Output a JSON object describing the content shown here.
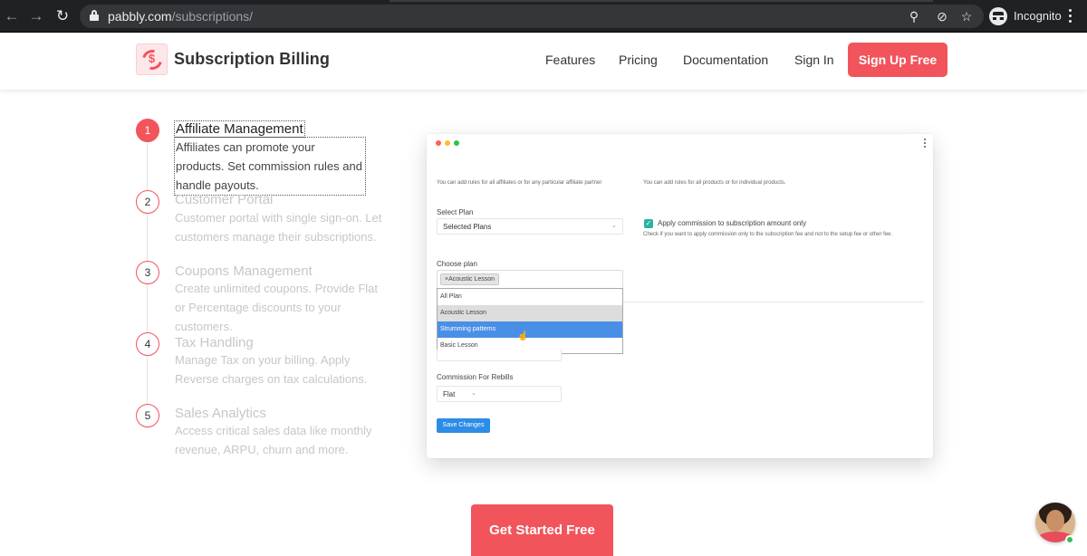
{
  "browser": {
    "url_host": "pabbly.com",
    "url_path": "/subscriptions/",
    "profile_label": "Incognito"
  },
  "header": {
    "brand": "Subscription Billing",
    "nav": [
      "Features",
      "Pricing",
      "Documentation",
      "Sign In"
    ],
    "cta": "Sign Up Free"
  },
  "features": [
    {
      "num": "1",
      "title": "Affiliate Management",
      "desc": "Affiliates can promote your products. Set commission rules and handle payouts.",
      "active": true
    },
    {
      "num": "2",
      "title": "Customer Portal",
      "desc": "Customer portal with single sign-on. Let customers manage their subscriptions.",
      "active": false
    },
    {
      "num": "3",
      "title": "Coupons Management",
      "desc": "Create unlimited coupons. Provide Flat or Percentage discounts to your customers.",
      "active": false
    },
    {
      "num": "4",
      "title": "Tax Handling",
      "desc": "Manage Tax on your billing. Apply Reverse charges on tax calculations.",
      "active": false
    },
    {
      "num": "5",
      "title": "Sales Analytics",
      "desc": "Access critical sales data like monthly revenue, ARPU, churn and more.",
      "active": false
    }
  ],
  "mockup": {
    "hint_left": "You can add rules for all affiliates or for any particular affiliate partner",
    "hint_right": "You can add rules for all products or for individual products.",
    "select_plan_label": "Select Plan",
    "select_plan_value": "Selected Plans",
    "checkbox_label": "Apply commission to subscription amount only",
    "checkbox_help": "Check if you want to apply commission only to the subscription fee and not to the setup fee or other fee.",
    "choose_plan_label": "Choose plan",
    "selected_tag": "×Acoustic Lesson",
    "options": [
      "All Plan",
      "Acoustic Lesson",
      "Strumming patterns",
      "Basic Lesson"
    ],
    "rebills_label": "Commission For Rebills",
    "rebills_value": "Flat",
    "save_button": "Save Changes",
    "colors": {
      "red": "#ff5f57",
      "yellow": "#febc2e",
      "green": "#28c840",
      "highlight": "#4a8fe6",
      "save": "#2d8ce6",
      "check": "#2bb3a0"
    }
  },
  "cta": "Get Started Free",
  "accent_color": "#f2545b"
}
